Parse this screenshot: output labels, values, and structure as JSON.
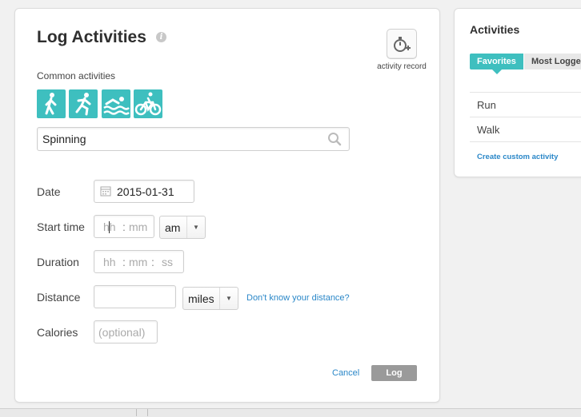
{
  "log": {
    "title": "Log Activities",
    "info_glyph": "i",
    "record_label": "activity record",
    "common_label": "Common activities",
    "common_icons": [
      "walking-icon",
      "running-icon",
      "swimming-icon",
      "cycling-icon"
    ],
    "search": {
      "value": "Spinning"
    },
    "date": {
      "label": "Date",
      "value": "2015-01-31"
    },
    "start_time": {
      "label": "Start time",
      "hh": "hh",
      "mm": "mm",
      "sep": ":",
      "ampm": "am"
    },
    "duration": {
      "label": "Duration",
      "hh": "hh",
      "mm": "mm",
      "ss": "ss",
      "sep1": ":",
      "sep2": ":"
    },
    "distance": {
      "label": "Distance",
      "unit": "miles",
      "help_link": "Don't know your distance?"
    },
    "calories": {
      "label": "Calories",
      "placeholder": "(optional)"
    },
    "cancel": "Cancel",
    "log_button": "Log",
    "accent": "#3ebfbf",
    "link_color": "#2a87c8"
  },
  "activities": {
    "title": "Activities",
    "tabs": [
      "Favorites",
      "Most Logge"
    ],
    "items": [
      "Run",
      "Walk"
    ],
    "create_link": "Create custom activity"
  }
}
